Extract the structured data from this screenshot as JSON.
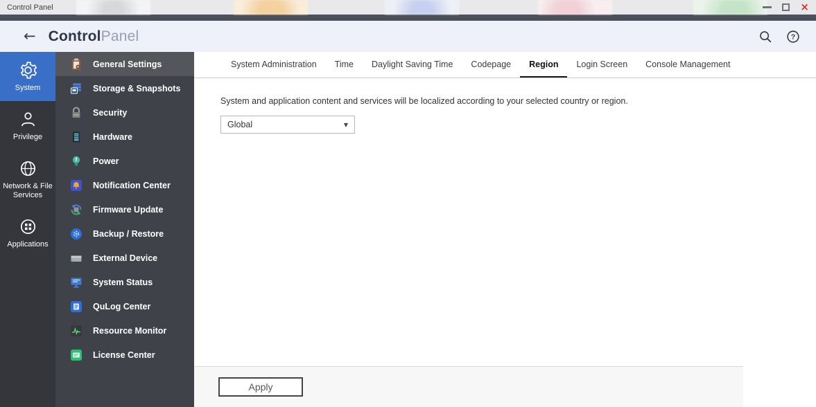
{
  "titlebar": {
    "title": "Control Panel"
  },
  "window_controls": {
    "close_glyph": "×"
  },
  "header": {
    "back_glyph": "←",
    "title_bold": "Control",
    "title_light": "Panel"
  },
  "icons": {
    "help_glyph": "?",
    "dropdown_arrow": "▼"
  },
  "nav_rail": {
    "items": [
      {
        "label": "System",
        "icon": "gear",
        "active": true
      },
      {
        "label": "Privilege",
        "icon": "user",
        "active": false
      },
      {
        "label": "Network & File Services",
        "icon": "globe",
        "active": false
      },
      {
        "label": "Applications",
        "icon": "apps",
        "active": false
      }
    ]
  },
  "menu": {
    "items": [
      {
        "label": "General Settings",
        "icon": "clipboard-gear",
        "active": true
      },
      {
        "label": "Storage & Snapshots",
        "icon": "storage-disks",
        "active": false
      },
      {
        "label": "Security",
        "icon": "padlock",
        "active": false
      },
      {
        "label": "Hardware",
        "icon": "nas-tower",
        "active": false
      },
      {
        "label": "Power",
        "icon": "power-bulb",
        "active": false
      },
      {
        "label": "Notification Center",
        "icon": "bell-tile",
        "active": false
      },
      {
        "label": "Firmware Update",
        "icon": "update-arrows",
        "active": false
      },
      {
        "label": "Backup / Restore",
        "icon": "backup-circle",
        "active": false
      },
      {
        "label": "External Device",
        "icon": "external-drive",
        "active": false
      },
      {
        "label": "System Status",
        "icon": "status-monitor",
        "active": false
      },
      {
        "label": "QuLog Center",
        "icon": "log-tile",
        "active": false
      },
      {
        "label": "Resource Monitor",
        "icon": "waveform-tile",
        "active": false
      },
      {
        "label": "License Center",
        "icon": "license-tile",
        "active": false
      }
    ]
  },
  "tabs": {
    "active": "Region",
    "items": [
      {
        "label": "System Administration",
        "active": false
      },
      {
        "label": "Time",
        "active": false
      },
      {
        "label": "Daylight Saving Time",
        "active": false
      },
      {
        "label": "Codepage",
        "active": false
      },
      {
        "label": "Region",
        "active": true
      },
      {
        "label": "Login Screen",
        "active": false
      },
      {
        "label": "Console Management",
        "active": false
      }
    ]
  },
  "panel": {
    "description": "System and application content and services will be localized according to your selected country or region.",
    "region_select": {
      "value": "Global"
    },
    "apply_label": "Apply"
  },
  "colors": {
    "accent_blue": "#3a6fc7",
    "rail_bg": "#34363c",
    "menu_bg": "#3f4248",
    "menu_active_bg": "#54565c",
    "header_bg": "#eef1fa",
    "close_red": "#d4342c",
    "active_tab_underline": "#1a1a1a"
  }
}
